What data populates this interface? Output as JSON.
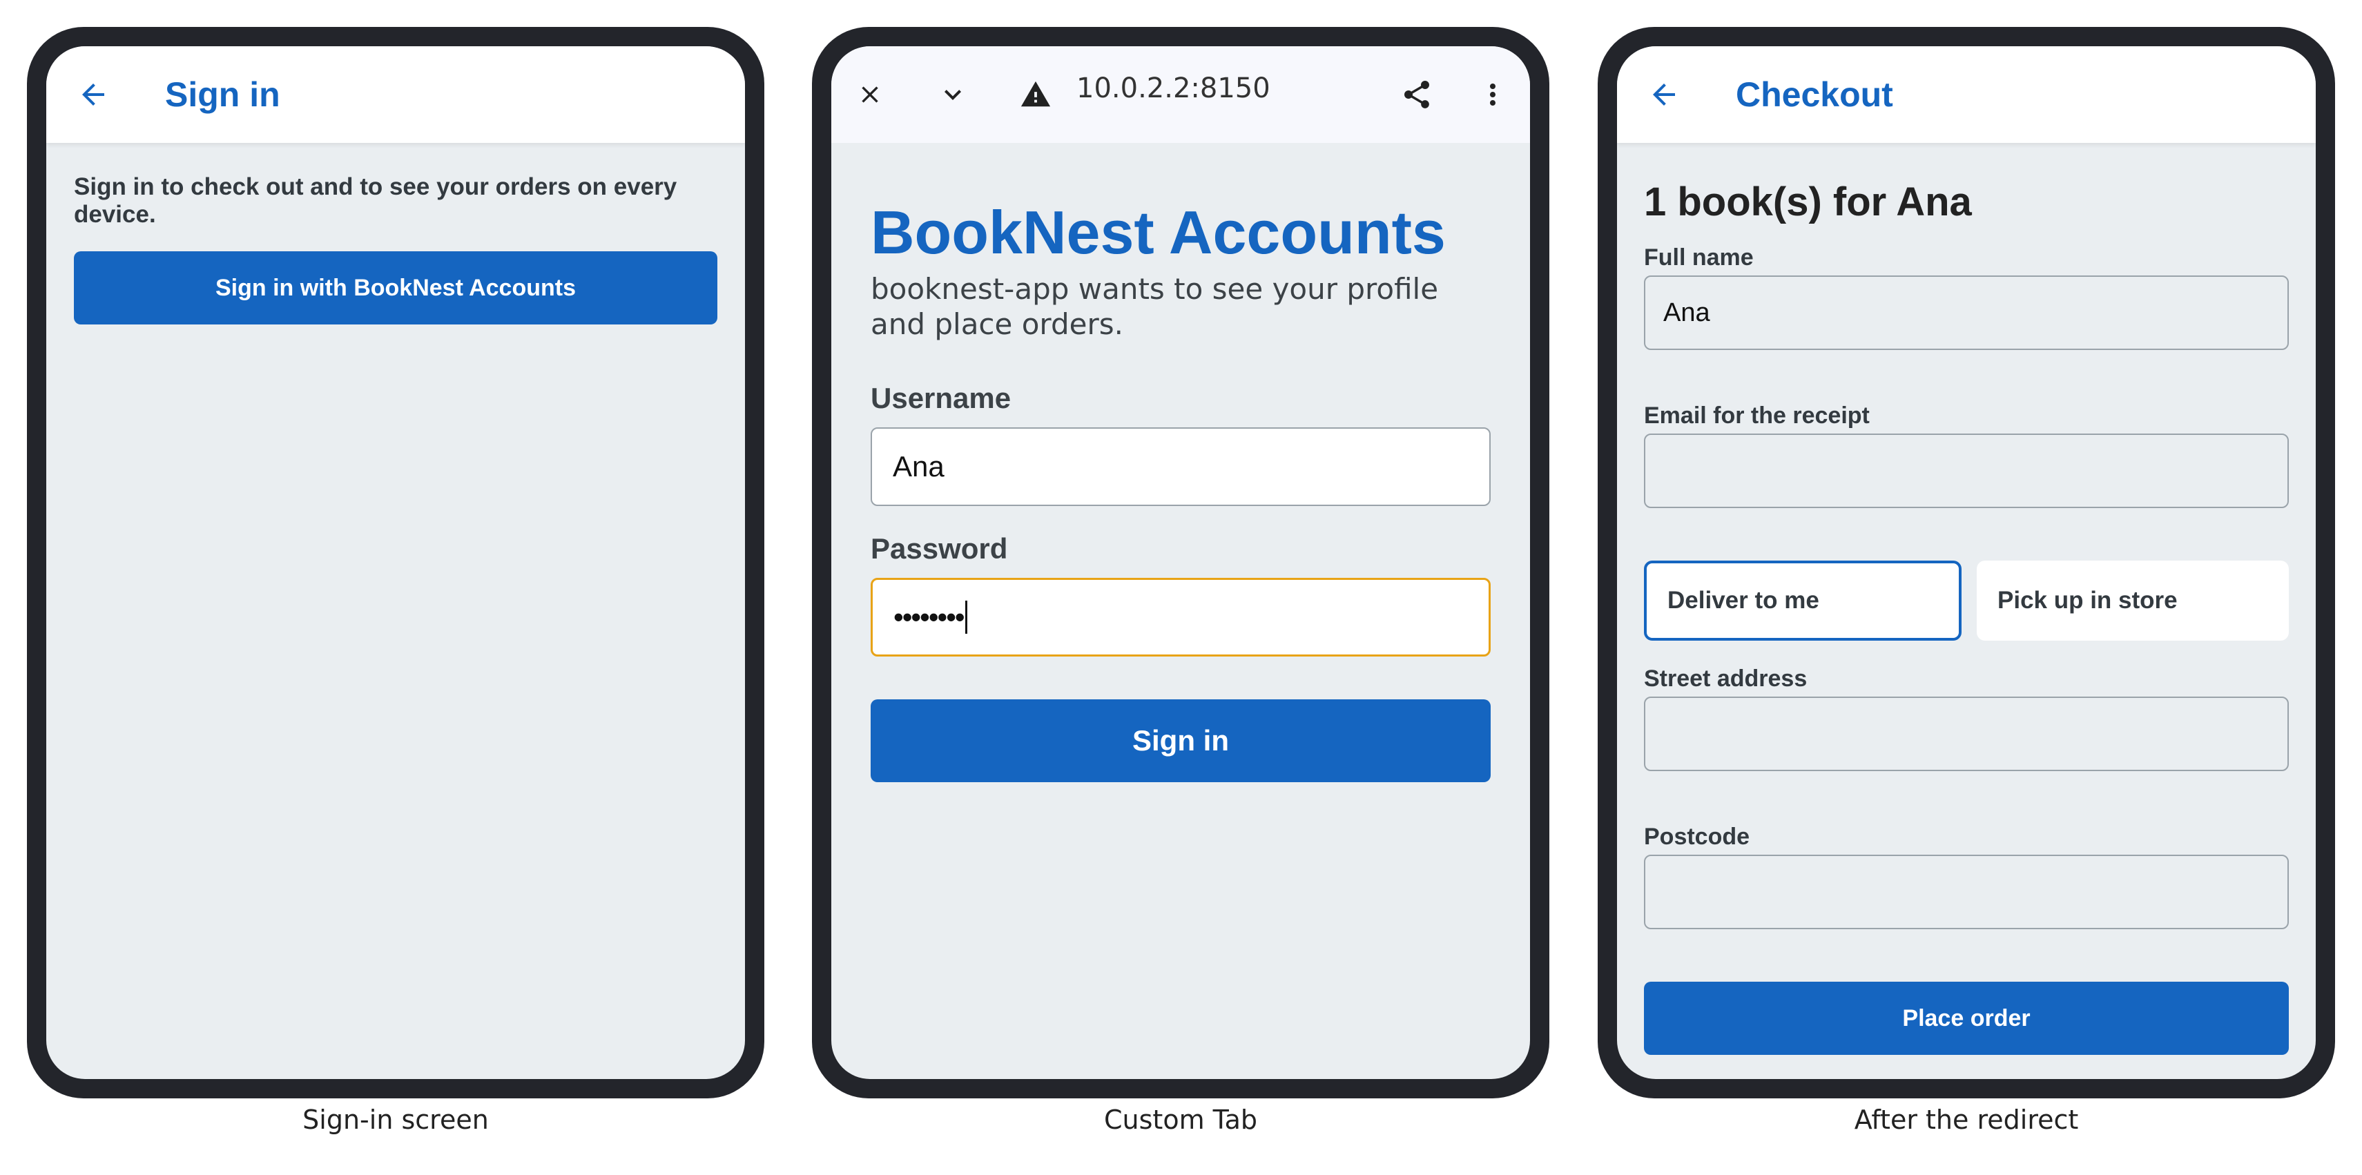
{
  "captions": [
    "Sign-in screen",
    "Custom Tab",
    "After the redirect"
  ],
  "phone1": {
    "appbar_title": "Sign in",
    "description": "Sign in to check out and to see your orders on every device.",
    "signin_button": "Sign in with BookNest Accounts"
  },
  "phone2": {
    "url": "10.0.2.2:8150",
    "heading": "BookNest Accounts",
    "subtitle": "booknest-app wants to see your profile and place orders.",
    "username_label": "Username",
    "username_value": "Ana",
    "password_label": "Password",
    "password_value": "••••••••",
    "signin_button": "Sign in"
  },
  "phone3": {
    "appbar_title": "Checkout",
    "heading": "1 book(s) for Ana",
    "fullname_label": "Full name",
    "fullname_value": "Ana",
    "email_label": "Email for the receipt",
    "email_value": "",
    "options": [
      "Deliver to me",
      "Pick up in store"
    ],
    "selected_option": "Deliver to me",
    "street_label": "Street address",
    "street_value": "",
    "postcode_label": "Postcode",
    "postcode_value": "",
    "place_order_button": "Place order"
  },
  "colors": {
    "accent": "#1565c0",
    "screen_bg": "#eaeef1",
    "frame": "#23252b",
    "focus_border": "#e8a317"
  }
}
